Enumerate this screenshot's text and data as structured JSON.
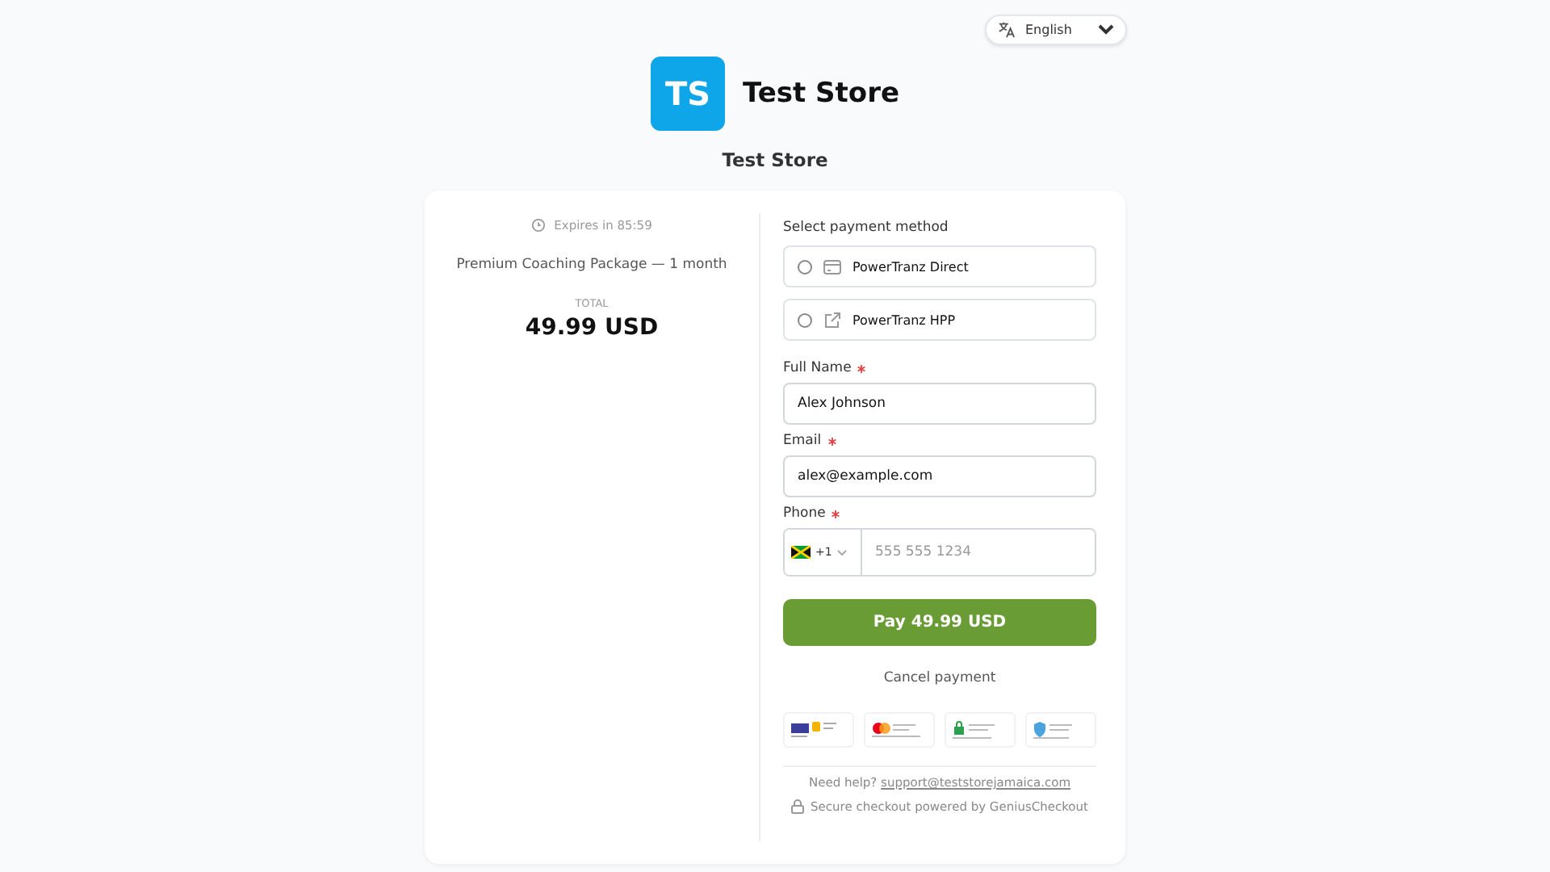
{
  "language_selector": {
    "value": "English"
  },
  "store": {
    "logo": "TS",
    "name": "Test Store",
    "subtitle": "Test Store"
  },
  "summary": {
    "expires": "Expires in 85:59",
    "product": "Premium Coaching Package — 1 month",
    "total_label": "TOTAL",
    "total": "49.99 USD"
  },
  "payment_methods": {
    "label": "Select payment method",
    "items": [
      {
        "kind": "card",
        "label": "PowerTranz Direct",
        "selected": false
      },
      {
        "kind": "external",
        "label": "PowerTranz HPP",
        "selected": false
      }
    ]
  },
  "fields": [
    {
      "label": "Full Name",
      "required": true,
      "value": "Alex Johnson"
    },
    {
      "label": "Email",
      "required": true,
      "value": "alex@example.com"
    }
  ],
  "phone": {
    "label": "Phone",
    "required": true,
    "code": "+1",
    "placeholder": "555 555 1234"
  },
  "pay_button": "Pay 49.99 USD",
  "cancel": "Cancel payment",
  "badges": [
    {
      "kind": "visa"
    },
    {
      "kind": "mastercard"
    },
    {
      "kind": "ssl"
    },
    {
      "kind": "pci"
    }
  ],
  "help": {
    "text": "Need help?",
    "email": "support@teststorejamaica.com"
  },
  "secure": "Secure checkout powered by GeniusCheckout"
}
